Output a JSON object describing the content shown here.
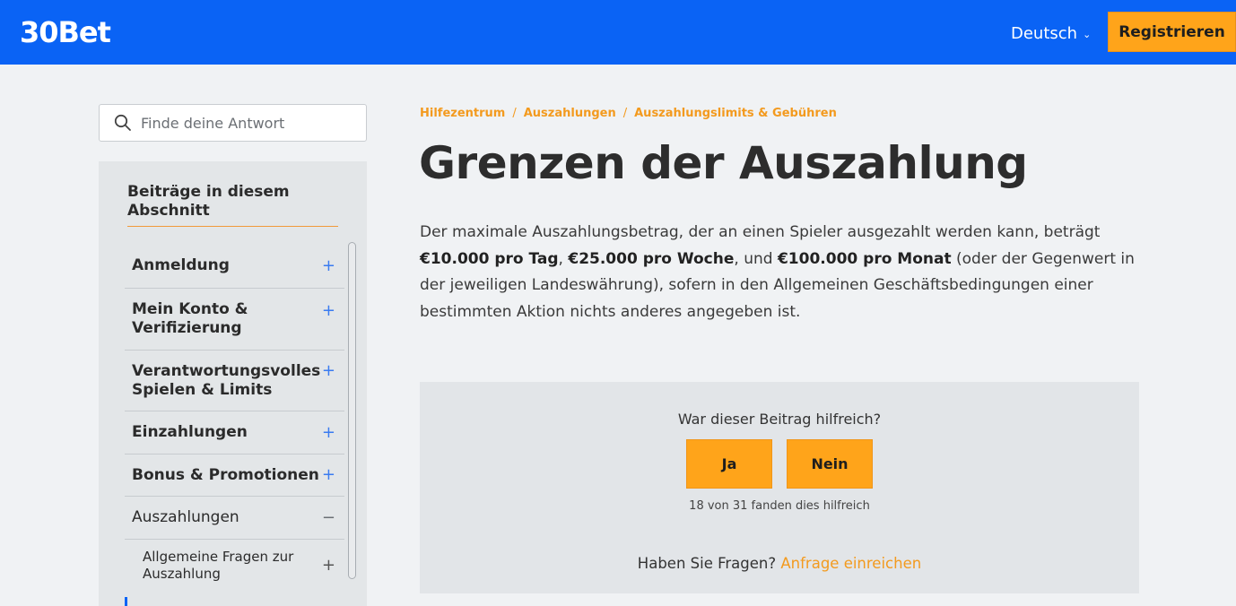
{
  "header": {
    "logo": "30Bet",
    "language": "Deutsch",
    "register_label": "Registrieren",
    "bg_color": "#0a63f5",
    "accent_color": "#ffa41a"
  },
  "search": {
    "placeholder": "Finde deine Antwort",
    "icon": "search-icon"
  },
  "sidebar": {
    "title": "Beiträge in diesem Abschnitt",
    "items": [
      {
        "label": "Anmeldung",
        "sign": "+"
      },
      {
        "label": "Mein Konto & Verifizierung",
        "sign": "+"
      },
      {
        "label": "Verantwortungsvolles Spielen & Limits",
        "sign": "+"
      },
      {
        "label": "Einzahlungen",
        "sign": "+"
      },
      {
        "label": "Bonus & Promotionen",
        "sign": "+"
      },
      {
        "label": "Auszahlungen",
        "sign": "−"
      }
    ],
    "subitems": [
      {
        "label": "Allgemeine Fragen zur Auszahlung",
        "sign": "+"
      }
    ]
  },
  "breadcrumb": {
    "items": [
      "Hilfezentrum",
      "Auszahlungen",
      "Auszahlungslimits & Gebühren"
    ],
    "separator": "/"
  },
  "article": {
    "title": "Grenzen der Auszahlung",
    "p_part1": "Der maximale Auszahlungsbetrag, der an einen Spieler ausgezahlt werden kann, beträgt ",
    "b1": "€10.000 pro Tag",
    "sep1": ", ",
    "b2": "€25.000 pro Woche",
    "sep2": ", und ",
    "b3": "€100.000 pro Monat",
    "p_part2": " (oder der Gegenwert in der jeweiligen Landeswährung), sofern in den Allgemeinen Geschäftsbedingungen einer bestimmten Aktion nichts anderes angegeben ist."
  },
  "feedback": {
    "question": "War dieser Beitrag hilfreich?",
    "yes_label": "Ja",
    "no_label": "Nein",
    "count_text": "18 von 31 fanden dies hilfreich",
    "ask_text": "Haben Sie Fragen? ",
    "ask_link": "Anfrage einreichen"
  }
}
